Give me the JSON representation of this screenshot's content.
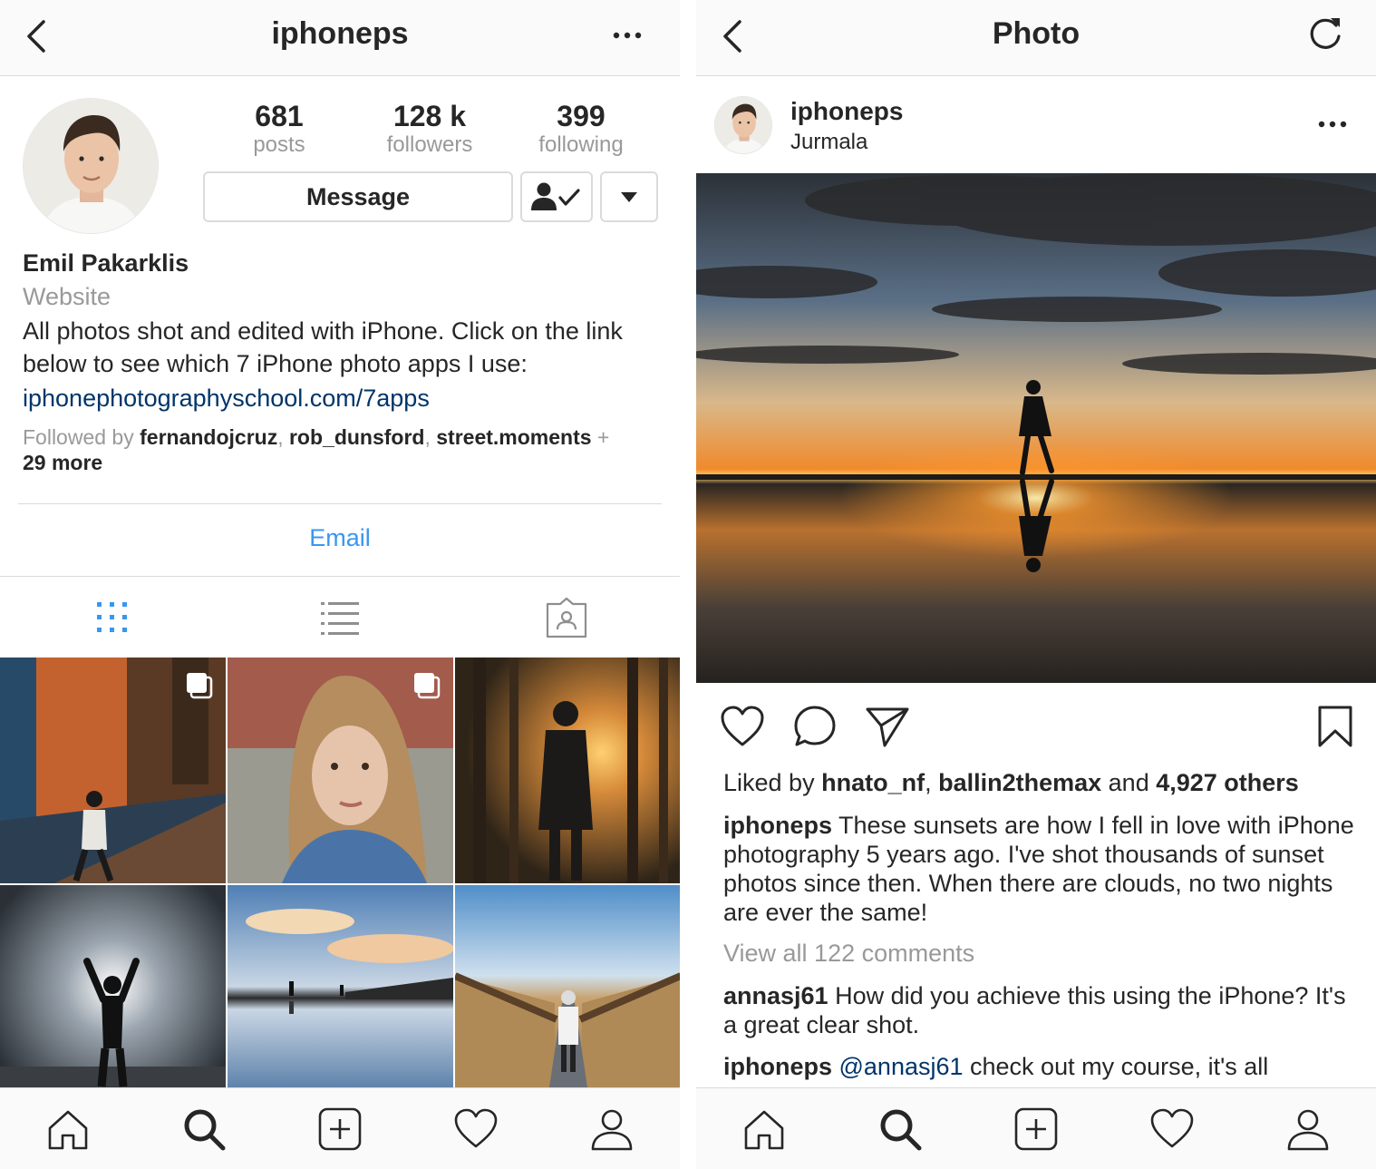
{
  "profile_screen": {
    "navbar": {
      "title": "iphoneps"
    },
    "stats": [
      {
        "value": "681",
        "label": "posts"
      },
      {
        "value": "128 k",
        "label": "followers"
      },
      {
        "value": "399",
        "label": "following"
      }
    ],
    "buttons": {
      "message": "Message"
    },
    "bio": {
      "name": "Emil Pakarklis",
      "website": "Website",
      "text": "All photos shot and edited with iPhone. Click on the link below to see which 7 iPhone photo apps I use:",
      "link": "iphonephotographyschool.com/7apps"
    },
    "followed_by": {
      "prefix": "Followed by ",
      "users": [
        "fernandojcruz",
        "rob_dunsford",
        "street.moments"
      ],
      "plus": " + ",
      "more": "29 more"
    },
    "email_label": "Email",
    "view_tabs": [
      "grid-view",
      "list-view",
      "tagged-view"
    ],
    "grid_photos": [
      "alley walker",
      "portrait woman",
      "forest sunset",
      "arms raised silhouette",
      "beach reflection",
      "boardwalk reeds"
    ]
  },
  "post_screen": {
    "navbar": {
      "title": "Photo"
    },
    "post": {
      "username": "iphoneps",
      "location": "Jurmala"
    },
    "likes": {
      "prefix": "Liked by ",
      "user1": "hnato_nf",
      "sep": ", ",
      "user2": "ballin2themax",
      "and": " and ",
      "others": "4,927 others"
    },
    "caption": {
      "username": "iphoneps",
      "text": " These sunsets are how I fell in love with iPhone photography 5 years ago. I've shot thousands of sunset photos since then. When there are clouds, no two nights are ever the same!"
    },
    "view_all": "View all 122 comments",
    "comments": [
      {
        "username": "annasj61",
        "text": " How did you achieve this using the iPhone? It's a great clear shot."
      },
      {
        "username": "iphoneps",
        "mention": " @annasj61",
        "text": " check out my course, it's all"
      }
    ]
  },
  "tabbar": [
    "home-icon",
    "search-icon",
    "add-icon",
    "heart-icon",
    "profile-icon"
  ],
  "colors": {
    "link": "#003569",
    "accent": "#3897f0",
    "muted": "#999999",
    "border": "#dbdbdb"
  }
}
